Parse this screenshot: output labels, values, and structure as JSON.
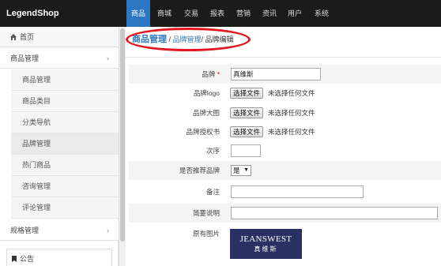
{
  "header": {
    "logo": "LegendShop",
    "nav": [
      "商品",
      "商城",
      "交易",
      "报表",
      "营销",
      "资讯",
      "用户",
      "系统"
    ],
    "active_index": 0
  },
  "sidebar": {
    "home": "首页",
    "group1": "商品管理",
    "group1_items": [
      "商品管理",
      "商品类目",
      "分类导航",
      "品牌管理",
      "热门商品",
      "咨询管理",
      "评论管理"
    ],
    "active_item": "品牌管理",
    "group2": "规格管理",
    "notice": "公告",
    "chevron": "›"
  },
  "breadcrumb": {
    "root": "商品管理",
    "sep1": " / ",
    "parent": "品牌管理",
    "sep2": "/ ",
    "current": "品牌编辑"
  },
  "form": {
    "brand_label": "品牌",
    "required_mark": "*",
    "brand_value": "真维斯",
    "logo_label": "品牌logo",
    "bigimg_label": "品牌大图",
    "auth_label": "品牌授权书",
    "file_button": "选择文件",
    "no_file": "未选择任何文件",
    "order_label": "次序",
    "order_value": "",
    "recommend_label": "是否推荐品牌",
    "recommend_value": "是",
    "remark_label": "备注",
    "remark_value": "",
    "brief_label": "简要说明",
    "brief_value": "",
    "orig_img_label": "原有图片",
    "image_text_en": "JEANSWEST",
    "image_text_cn": "真维斯"
  },
  "colors": {
    "topbar": "#1b1b1b",
    "accent": "#2c78c4",
    "highlight": "#e0171e",
    "brand_bg": "#2a3062"
  }
}
